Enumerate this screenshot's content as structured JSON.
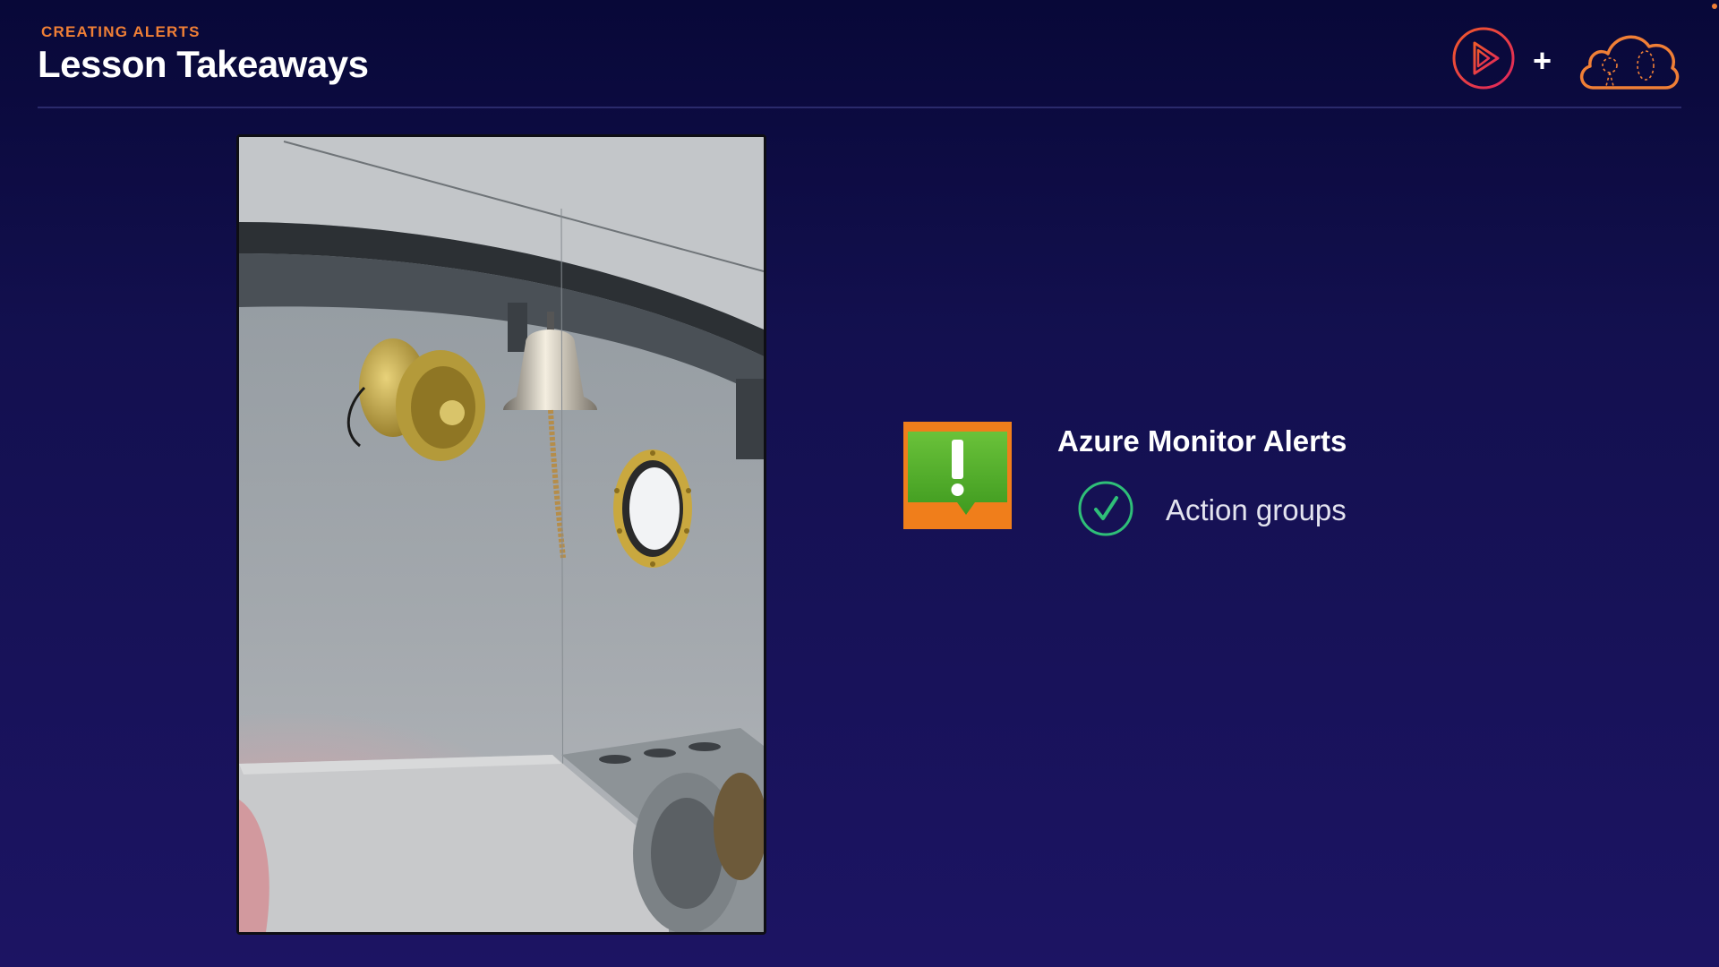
{
  "header": {
    "eyebrow": "CREATING ALERTS",
    "title": "Lesson Takeaways",
    "plus": "+",
    "logos": [
      "play-logo-icon",
      "cloud-logo-icon"
    ]
  },
  "photo": {
    "subject": "ship-bell-horn-photo"
  },
  "section": {
    "title": "Azure Monitor Alerts",
    "icon": "alert-exclamation-icon",
    "items": [
      {
        "label": "Action groups",
        "icon": "check-circle-icon"
      }
    ]
  },
  "colors": {
    "accent_orange": "#f07f36",
    "accent_pink": "#e8315b",
    "check_green": "#2fbf78",
    "alert_green": "#56b12d",
    "alert_orange": "#f07e1b",
    "background": "#13104f"
  }
}
